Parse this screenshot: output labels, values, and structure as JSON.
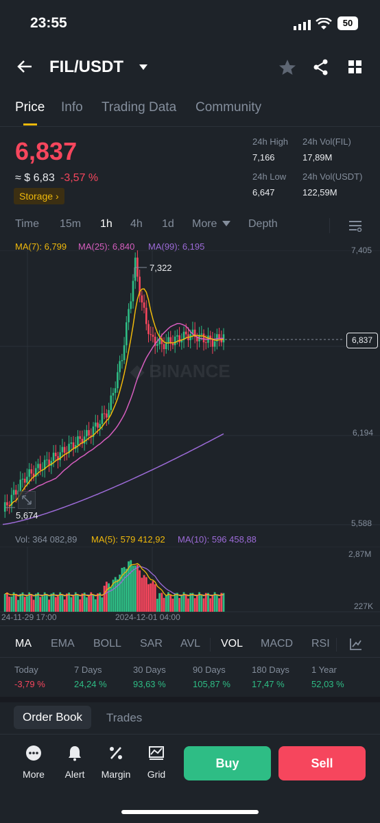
{
  "status": {
    "time": "23:55",
    "battery": "50"
  },
  "header": {
    "pair": "FIL/USDT"
  },
  "tabs": [
    "Price",
    "Info",
    "Trading Data",
    "Community"
  ],
  "price": {
    "last": "6,837",
    "usd": "≈ $ 6,83",
    "change": "-3,57 %",
    "tag": "Storage",
    "high_label": "24h High",
    "high": "7,166",
    "low_label": "24h Low",
    "low": "6,647",
    "vol_fil_label": "24h Vol(FIL)",
    "vol_fil": "17,89M",
    "vol_usdt_label": "24h Vol(USDT)",
    "vol_usdt": "122,59M"
  },
  "intervals": [
    "Time",
    "15m",
    "1h",
    "4h",
    "1d",
    "More",
    "Depth"
  ],
  "ma": {
    "ma7": "MA(7): 6,799",
    "ma25": "MA(25): 6,840",
    "ma99": "MA(99): 6,195"
  },
  "chart_axis": {
    "top": "7,405",
    "mid": "6,194",
    "bottom": "5,588",
    "current": "6,837",
    "high_mark": "7,322",
    "low_mark": "5,674"
  },
  "vol_header": {
    "vol": "Vol: 364 082,89",
    "ma5": "MA(5): 579 412,92",
    "ma10": "MA(10): 596 458,88"
  },
  "vol_axis": {
    "top": "2,87M",
    "bottom": "227K"
  },
  "time_axis": {
    "left": "24-11-29 17:00",
    "mid": "2024-12-01 04:00"
  },
  "indicators": [
    "MA",
    "EMA",
    "BOLL",
    "SAR",
    "AVL",
    "VOL",
    "MACD",
    "RSI"
  ],
  "performance": [
    {
      "label": "Today",
      "value": "-3,79 %"
    },
    {
      "label": "7 Days",
      "value": "24,24 %"
    },
    {
      "label": "30 Days",
      "value": "93,63 %"
    },
    {
      "label": "90 Days",
      "value": "105,87 %"
    },
    {
      "label": "180 Days",
      "value": "17,47 %"
    },
    {
      "label": "1 Year",
      "value": "52,03 %"
    }
  ],
  "orderbook_tabs": [
    "Order Book",
    "Trades"
  ],
  "bottom": {
    "more": "More",
    "alert": "Alert",
    "margin": "Margin",
    "grid": "Grid",
    "buy": "Buy",
    "sell": "Sell"
  },
  "colors": {
    "up": "#2ebd85",
    "down": "#f6465d",
    "accent": "#f0b90b",
    "bg": "#1e2329"
  }
}
